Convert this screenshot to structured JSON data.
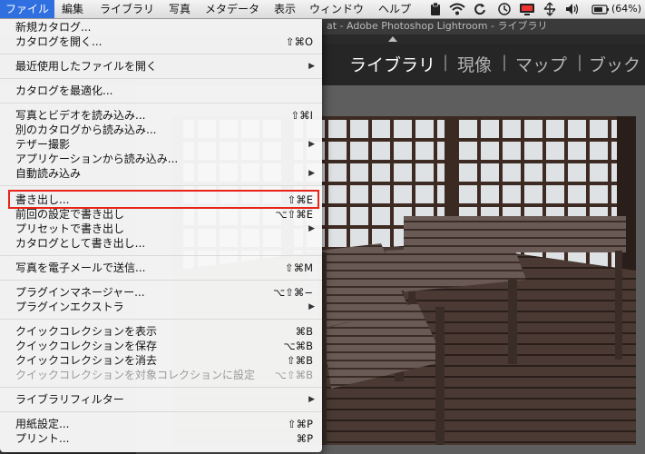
{
  "menubar": {
    "items": [
      "ファイル",
      "編集",
      "ライブラリ",
      "写真",
      "メタデータ",
      "表示",
      "ウィンドウ",
      "ヘルプ"
    ],
    "battery": "(64%)"
  },
  "window": {
    "title": "at - Adobe Photoshop Lightroom - ライブラリ",
    "modules": [
      "ライブラリ",
      "現像",
      "マップ",
      "ブック"
    ],
    "separator": "|"
  },
  "file_menu": {
    "rows": [
      {
        "label": "新規カタログ...",
        "shortcut": ""
      },
      {
        "label": "カタログを開く...",
        "shortcut": "⇧⌘O"
      },
      {
        "label": "最近使用したファイルを開く",
        "shortcut": ""
      },
      {
        "label": "カタログを最適化...",
        "shortcut": ""
      },
      {
        "label": "写真とビデオを読み込み...",
        "shortcut": "⇧⌘I"
      },
      {
        "label": "別のカタログから読み込み...",
        "shortcut": ""
      },
      {
        "label": "テザー撮影",
        "shortcut": ""
      },
      {
        "label": "アプリケーションから読み込み...",
        "shortcut": ""
      },
      {
        "label": "自動読み込み",
        "shortcut": ""
      },
      {
        "label": "書き出し...",
        "shortcut": "⇧⌘E"
      },
      {
        "label": "前回の設定で書き出し",
        "shortcut": "⌥⇧⌘E"
      },
      {
        "label": "プリセットで書き出し",
        "shortcut": ""
      },
      {
        "label": "カタログとして書き出し...",
        "shortcut": ""
      },
      {
        "label": "写真を電子メールで送信...",
        "shortcut": "⇧⌘M"
      },
      {
        "label": "プラグインマネージャー...",
        "shortcut": "⌥⇧⌘−"
      },
      {
        "label": "プラグインエクストラ",
        "shortcut": ""
      },
      {
        "label": "クイックコレクションを表示",
        "shortcut": "⌘B"
      },
      {
        "label": "クイックコレクションを保存",
        "shortcut": "⌥⌘B"
      },
      {
        "label": "クイックコレクションを消去",
        "shortcut": "⇧⌘B"
      },
      {
        "label": "クイックコレクションを対象コレクションに設定",
        "shortcut": "⌥⇧⌘B"
      },
      {
        "label": "ライブラリフィルター",
        "shortcut": ""
      },
      {
        "label": "用紙設定...",
        "shortcut": "⇧⌘P"
      },
      {
        "label": "プリント...",
        "shortcut": "⌘P"
      }
    ]
  },
  "colors": {
    "menu_highlight": "#2f6fe0",
    "annotation_box": "#e8231a"
  }
}
